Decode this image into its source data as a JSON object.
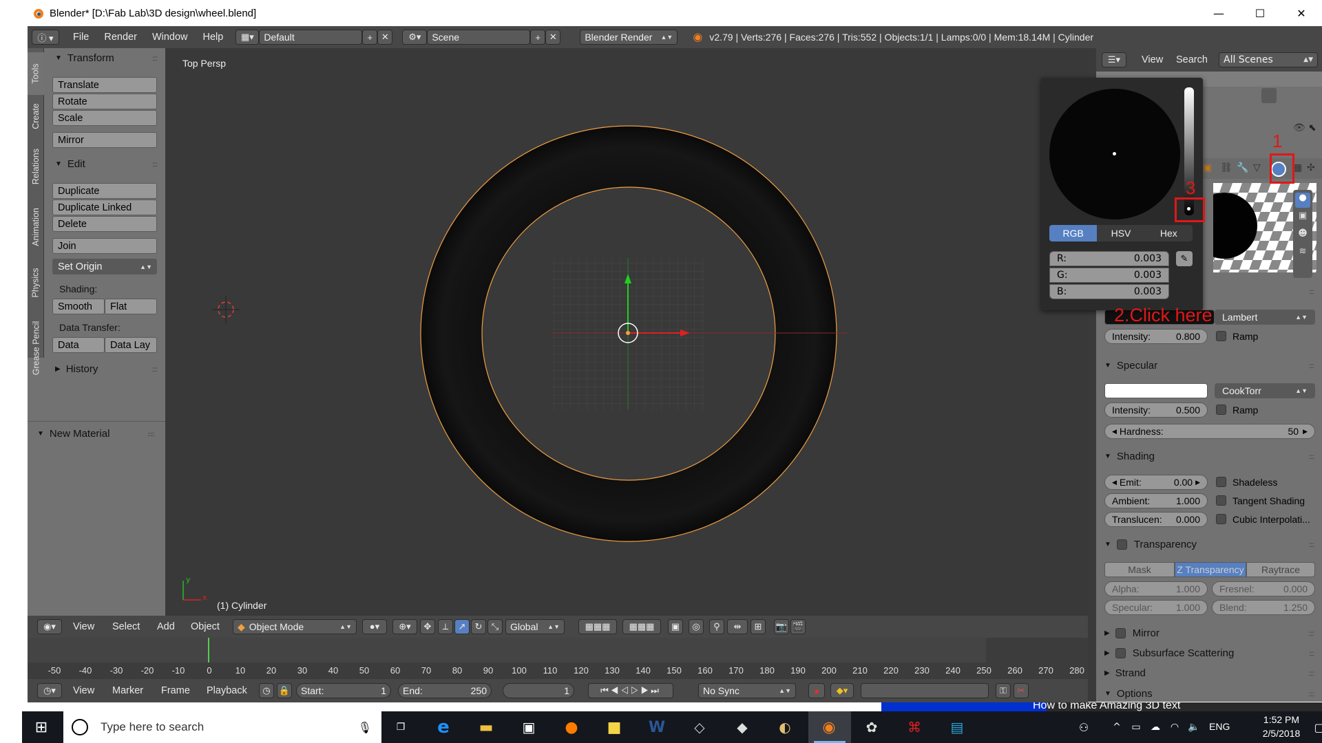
{
  "window": {
    "title": "Blender* [D:\\Fab Lab\\3D design\\wheel.blend]",
    "minimize": "—",
    "maximize": "☐",
    "close": "✕"
  },
  "header": {
    "menus": [
      "File",
      "Render",
      "Window",
      "Help"
    ],
    "screen_layout": "Default",
    "scene": "Scene",
    "engine": "Blender Render",
    "stats": "v2.79 | Verts:276 | Faces:276 | Tris:552 | Objects:1/1 | Lamps:0/0 | Mem:18.14M | Cylinder"
  },
  "tool_tabs": [
    "Tools",
    "Create",
    "Relations",
    "Animation",
    "Physics",
    "Grease Pencil"
  ],
  "tools": {
    "transform_header": "Transform",
    "translate": "Translate",
    "rotate": "Rotate",
    "scale": "Scale",
    "mirror": "Mirror",
    "edit_header": "Edit",
    "duplicate": "Duplicate",
    "duplicate_linked": "Duplicate Linked",
    "delete": "Delete",
    "join": "Join",
    "set_origin": "Set Origin",
    "shading_label": "Shading:",
    "smooth": "Smooth",
    "flat": "Flat",
    "data_transfer_label": "Data Transfer:",
    "data": "Data",
    "data_lay": "Data Lay",
    "history_header": "History",
    "new_material_header": "New Material"
  },
  "viewport": {
    "view_name": "Top Persp",
    "object_label": "(1) Cylinder",
    "axis_x": "x",
    "axis_y": "y"
  },
  "viewport_bar": {
    "menus": [
      "View",
      "Select",
      "Add",
      "Object"
    ],
    "mode": "Object Mode",
    "orientation": "Global"
  },
  "timeline": {
    "ticks": [
      "-50",
      "-40",
      "-30",
      "-20",
      "-10",
      "0",
      "10",
      "20",
      "30",
      "40",
      "50",
      "60",
      "70",
      "80",
      "90",
      "100",
      "110",
      "120",
      "130",
      "140",
      "150",
      "160",
      "170",
      "180",
      "190",
      "200",
      "210",
      "220",
      "230",
      "240",
      "250",
      "260",
      "270",
      "280"
    ],
    "current_frame_value": 0
  },
  "timeline_bar": {
    "menus": [
      "View",
      "Marker",
      "Frame",
      "Playback"
    ],
    "start_label": "Start:",
    "start": "1",
    "end_label": "End:",
    "end": "250",
    "current": "1",
    "sync": "No Sync"
  },
  "outliner": {
    "view": "View",
    "search": "Search",
    "scope": "All Scenes"
  },
  "color_picker": {
    "tabs": [
      "RGB",
      "HSV",
      "Hex"
    ],
    "r_label": "R:",
    "r": "0.003",
    "g_label": "G:",
    "g": "0.003",
    "b_label": "B:",
    "b": "0.003"
  },
  "annotations": {
    "a1": "1",
    "a2": "2.Click here",
    "a3": "3"
  },
  "material": {
    "diffuse_shader": "Lambert",
    "diffuse_intensity_label": "Intensity:",
    "diffuse_intensity": "0.800",
    "diffuse_ramp": "Ramp",
    "specular_header": "Specular",
    "specular_shader": "CookTorr",
    "spec_intensity_label": "Intensity:",
    "spec_intensity": "0.500",
    "spec_ramp": "Ramp",
    "hardness_label": "Hardness:",
    "hardness": "50",
    "shading_header": "Shading",
    "emit_label": "Emit:",
    "emit": "0.00",
    "shadeless": "Shadeless",
    "ambient_label": "Ambient:",
    "ambient": "1.000",
    "tangent": "Tangent Shading",
    "transluc_label": "Translucen:",
    "transluc": "0.000",
    "cubic": "Cubic Interpolati...",
    "transparency_header": "Transparency",
    "mask": "Mask",
    "ztrans": "Z Transparency",
    "raytrace": "Raytrace",
    "alpha_label": "Alpha:",
    "alpha": "1.000",
    "fresnel_label": "Fresnel:",
    "fresnel": "0.000",
    "specular_label": "Specular:",
    "specular": "1.000",
    "blend_label": "Blend:",
    "blend": "1.250",
    "mirror_header": "Mirror",
    "sss_header": "Subsurface Scattering",
    "strand_header": "Strand",
    "options_header": "Options"
  },
  "taskbar": {
    "search": "Type here to search",
    "time": "1:52 PM",
    "date": "2/5/2018",
    "lang": "ENG",
    "bg_window": "How to make Amazing 3D text"
  },
  "colors": {
    "accent": "#5680c2",
    "selection": "#f0a040",
    "annotation": "#e01818"
  }
}
